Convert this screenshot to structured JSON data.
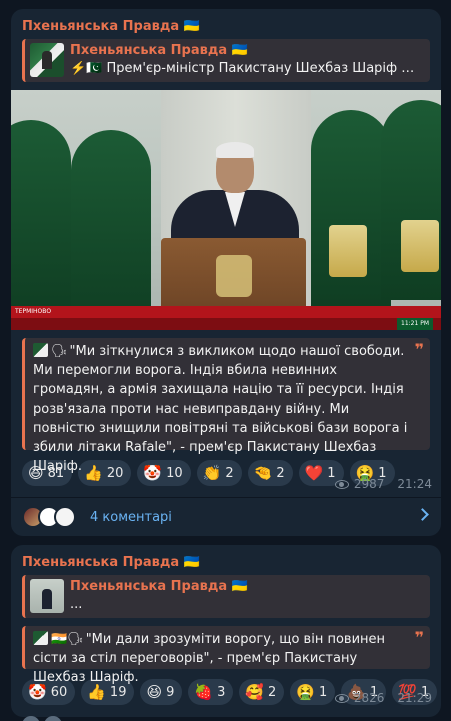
{
  "messages": [
    {
      "channel": "Пхеньянська Правда 🇺🇦",
      "reply": {
        "name": "Пхеньянська Правда 🇺🇦",
        "text": "⚡️🇵🇰 Прем'єр-міністр Пакистану Шехбаз Шаріф не..."
      },
      "photo": {
        "ticker_label": "ТЕРМІНОВО",
        "ticker_time": "11:21 PM"
      },
      "quote_prefix": "🗣",
      "quote": "\"Ми зіткнулися з викликом щодо нашої свободи. Ми перемогли ворога. Індія вбила невинних громадян, а армія захищала націю та її ресурси. Індія розв'язала проти нас невиправдану війну. Ми повністю знищили повітряні та військові бази ворога і збили літаки Rafale\", - прем'єр Пакистану Шехбаз Шаріф.",
      "reactions": [
        {
          "emoji": "😆",
          "count": "81"
        },
        {
          "emoji": "👍",
          "count": "20"
        },
        {
          "emoji": "🤡",
          "count": "10"
        },
        {
          "emoji": "👏",
          "count": "2"
        },
        {
          "emoji": "🤏",
          "count": "2"
        },
        {
          "emoji": "❤️",
          "count": "1"
        },
        {
          "emoji": "🤮",
          "count": "1"
        }
      ],
      "views": "2987",
      "time": "21:24",
      "comments": "4 коментарі"
    },
    {
      "channel": "Пхеньянська Правда 🇺🇦",
      "reply": {
        "name": "Пхеньянська Правда 🇺🇦",
        "text": "..."
      },
      "quote_prefix": "🇮🇳🗣",
      "quote": "\"Ми дали зрозуміти ворогу, що він повинен сісти за стіл переговорів\", - прем'єр Пакистану Шехбаз Шаріф.",
      "reactions": [
        {
          "emoji": "🤡",
          "count": "60"
        },
        {
          "emoji": "👍",
          "count": "19"
        },
        {
          "emoji": "😆",
          "count": "9"
        },
        {
          "emoji": "🍓",
          "count": "3"
        },
        {
          "emoji": "🥰",
          "count": "2"
        },
        {
          "emoji": "🤮",
          "count": "1"
        },
        {
          "emoji": "💩",
          "count": "1"
        },
        {
          "emoji": "💯",
          "count": "1"
        }
      ],
      "views": "2826",
      "time": "21:29"
    }
  ],
  "colors": {
    "background": "#0e1621",
    "bubble": "#182533",
    "accent": "#e8734f",
    "link": "#6ab3f3",
    "meta": "#7e8b98"
  }
}
